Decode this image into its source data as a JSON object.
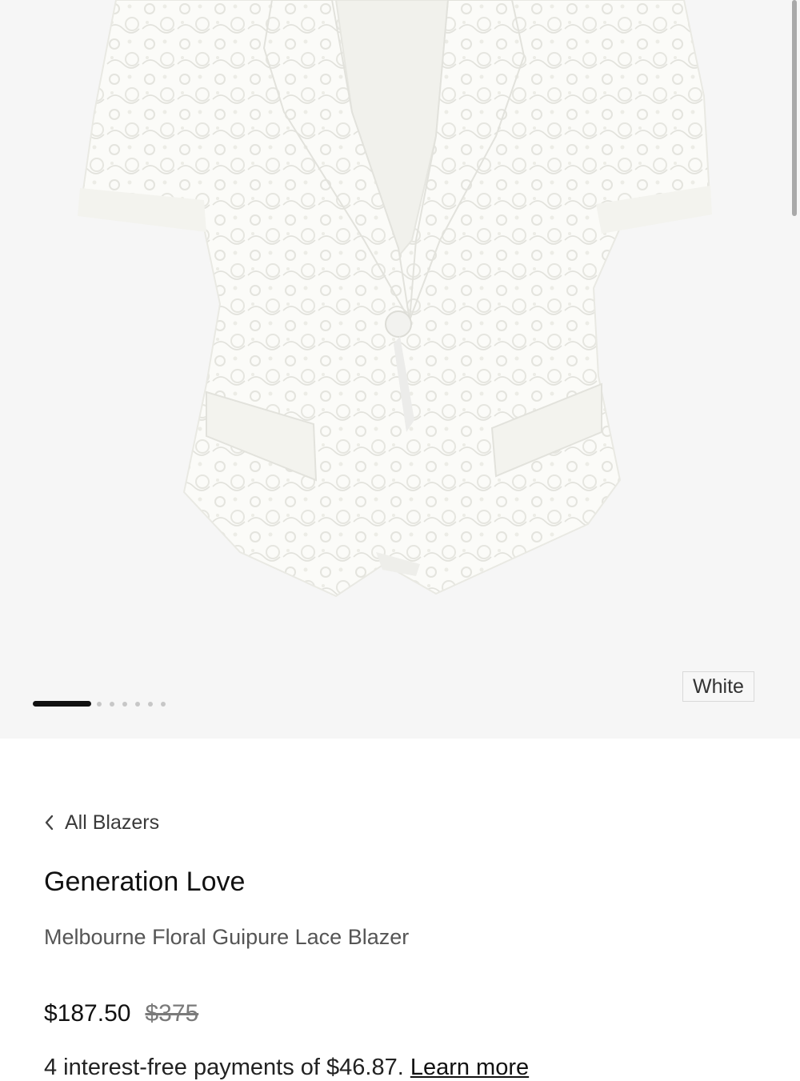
{
  "gallery": {
    "image_alt": "White floral guipure lace short-sleeve blazer",
    "image_count": 7,
    "active_index": 0,
    "color_label": "White"
  },
  "breadcrumb": {
    "label": "All Blazers"
  },
  "product": {
    "brand": "Generation Love",
    "name": "Melbourne Floral Guipure Lace Blazer",
    "price_sale": "$187.50",
    "price_original": "$375",
    "installments_text": "4 interest-free payments of $46.87.",
    "learn_more": "Learn more"
  },
  "colors": {
    "gallery_bg": "#f6f6f6",
    "accent": "#111111"
  }
}
